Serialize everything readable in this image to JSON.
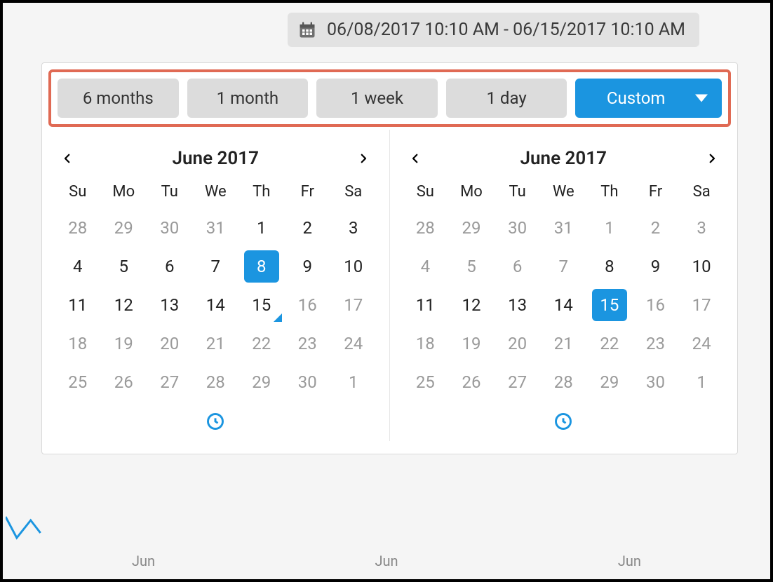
{
  "range_display": "06/08/2017 10:10 AM - 06/15/2017 10:10 AM",
  "presets": {
    "six_months": "6 months",
    "one_month": "1 month",
    "one_week": "1 week",
    "one_day": "1 day",
    "custom": "Custom"
  },
  "calendar_left": {
    "title": "June 2017",
    "dow": [
      "Su",
      "Mo",
      "Tu",
      "We",
      "Th",
      "Fr",
      "Sa"
    ],
    "weeks": [
      [
        {
          "d": "28",
          "dis": true
        },
        {
          "d": "29",
          "dis": true
        },
        {
          "d": "30",
          "dis": true
        },
        {
          "d": "31",
          "dis": true
        },
        {
          "d": "1"
        },
        {
          "d": "2"
        },
        {
          "d": "3"
        }
      ],
      [
        {
          "d": "4"
        },
        {
          "d": "5"
        },
        {
          "d": "6"
        },
        {
          "d": "7"
        },
        {
          "d": "8",
          "sel": true
        },
        {
          "d": "9"
        },
        {
          "d": "10"
        }
      ],
      [
        {
          "d": "11"
        },
        {
          "d": "12"
        },
        {
          "d": "13"
        },
        {
          "d": "14"
        },
        {
          "d": "15",
          "today": true
        },
        {
          "d": "16",
          "dis": true
        },
        {
          "d": "17",
          "dis": true
        }
      ],
      [
        {
          "d": "18",
          "dis": true
        },
        {
          "d": "19",
          "dis": true
        },
        {
          "d": "20",
          "dis": true
        },
        {
          "d": "21",
          "dis": true
        },
        {
          "d": "22",
          "dis": true
        },
        {
          "d": "23",
          "dis": true
        },
        {
          "d": "24",
          "dis": true
        }
      ],
      [
        {
          "d": "25",
          "dis": true
        },
        {
          "d": "26",
          "dis": true
        },
        {
          "d": "27",
          "dis": true
        },
        {
          "d": "28",
          "dis": true
        },
        {
          "d": "29",
          "dis": true
        },
        {
          "d": "30",
          "dis": true
        },
        {
          "d": "1",
          "dis": true
        }
      ]
    ]
  },
  "calendar_right": {
    "title": "June 2017",
    "dow": [
      "Su",
      "Mo",
      "Tu",
      "We",
      "Th",
      "Fr",
      "Sa"
    ],
    "weeks": [
      [
        {
          "d": "28",
          "dis": true
        },
        {
          "d": "29",
          "dis": true
        },
        {
          "d": "30",
          "dis": true
        },
        {
          "d": "31",
          "dis": true
        },
        {
          "d": "1",
          "dis": true
        },
        {
          "d": "2",
          "dis": true
        },
        {
          "d": "3",
          "dis": true
        }
      ],
      [
        {
          "d": "4",
          "dis": true
        },
        {
          "d": "5",
          "dis": true
        },
        {
          "d": "6",
          "dis": true
        },
        {
          "d": "7",
          "dis": true
        },
        {
          "d": "8"
        },
        {
          "d": "9"
        },
        {
          "d": "10"
        }
      ],
      [
        {
          "d": "11"
        },
        {
          "d": "12"
        },
        {
          "d": "13"
        },
        {
          "d": "14"
        },
        {
          "d": "15",
          "sel": true
        },
        {
          "d": "16",
          "dis": true
        },
        {
          "d": "17",
          "dis": true
        }
      ],
      [
        {
          "d": "18",
          "dis": true
        },
        {
          "d": "19",
          "dis": true
        },
        {
          "d": "20",
          "dis": true
        },
        {
          "d": "21",
          "dis": true
        },
        {
          "d": "22",
          "dis": true
        },
        {
          "d": "23",
          "dis": true
        },
        {
          "d": "24",
          "dis": true
        }
      ],
      [
        {
          "d": "25",
          "dis": true
        },
        {
          "d": "26",
          "dis": true
        },
        {
          "d": "27",
          "dis": true
        },
        {
          "d": "28",
          "dis": true
        },
        {
          "d": "29",
          "dis": true
        },
        {
          "d": "30",
          "dis": true
        },
        {
          "d": "1",
          "dis": true
        }
      ]
    ]
  },
  "axis_labels": [
    "Jun",
    "Jun",
    "Jun"
  ],
  "colors": {
    "accent": "#1b95e0",
    "highlight_border": "#e06a54"
  }
}
